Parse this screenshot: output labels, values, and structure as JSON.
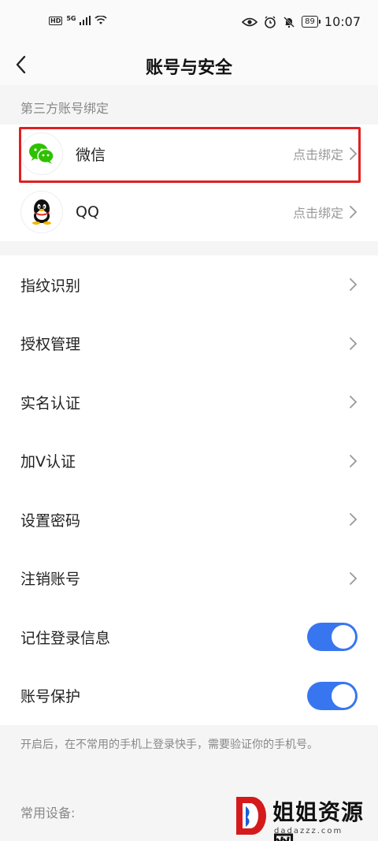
{
  "status_bar": {
    "hd": "HD",
    "network": "5G",
    "battery": "89",
    "time": "10:07"
  },
  "nav": {
    "title": "账号与安全"
  },
  "third_party": {
    "section_label": "第三方账号绑定",
    "accounts": [
      {
        "name": "微信",
        "action": "点击绑定",
        "icon": "wechat-icon"
      },
      {
        "name": "QQ",
        "action": "点击绑定",
        "icon": "qq-icon"
      }
    ]
  },
  "menu": {
    "items": [
      {
        "label": "指纹识别"
      },
      {
        "label": "授权管理"
      },
      {
        "label": "实名认证"
      },
      {
        "label": "加V认证"
      },
      {
        "label": "设置密码"
      },
      {
        "label": "注销账号"
      }
    ]
  },
  "toggles": {
    "items": [
      {
        "label": "记住登录信息",
        "on": true
      },
      {
        "label": "账号保护",
        "on": true
      }
    ]
  },
  "hint": "开启后，在不常用的手机上登录快手，需要验证你的手机号。",
  "devices": {
    "label": "常用设备:"
  },
  "watermark": {
    "text": "姐姐资源网",
    "sub": "dadazzz.com"
  },
  "colors": {
    "accent": "#3876f0",
    "highlight": "#e02020",
    "wechat": "#2dc100"
  }
}
